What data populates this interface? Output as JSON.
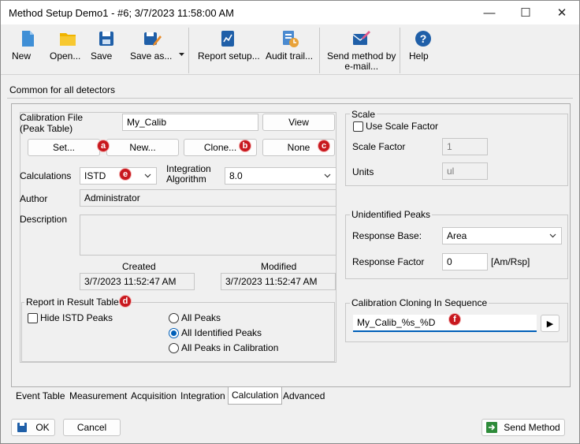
{
  "window": {
    "title": "Method Setup Demo1 - #6;  3/7/2023   11:58:00 AM",
    "minimize_glyph": "—",
    "maximize_glyph": "☐",
    "close_glyph": "✕"
  },
  "toolbar": {
    "new": "New",
    "open": "Open...",
    "save": "Save",
    "save_as": "Save as...",
    "report_setup": "Report setup...",
    "audit_trail": "Audit trail...",
    "send_method_line1": "Send method by",
    "send_method_line2": "e-mail...",
    "help": "Help"
  },
  "common_label": "Common for all detectors",
  "calibration": {
    "file_label_line1": "Calibration File",
    "file_label_line2": "(Peak Table)",
    "file_value": "My_Calib",
    "view_button": "View",
    "set_button": "Set...",
    "new_button": "New...",
    "clone_button": "Clone...",
    "none_button": "None",
    "calculations_label": "Calculations",
    "calculations_value": "ISTD",
    "integration_label_line1": "Integration",
    "integration_label_line2": "Algorithm",
    "integration_value": "8.0",
    "author_label": "Author",
    "author_value": "Administrator",
    "description_label": "Description",
    "description_value": "",
    "created_label": "Created",
    "created_value": "3/7/2023 11:52:47 AM",
    "modified_label": "Modified",
    "modified_value": "3/7/2023 11:52:47 AM"
  },
  "report": {
    "title": "Report in Result Table",
    "hide_istd": "Hide ISTD Peaks",
    "all_peaks": "All Peaks",
    "all_identified": "All Identified Peaks",
    "all_in_calibration": "All Peaks in Calibration",
    "selected": "all_identified"
  },
  "scale": {
    "title": "Scale",
    "use_scale_factor": "Use Scale Factor",
    "scale_factor_label": "Scale Factor",
    "scale_factor_value": "1",
    "units_label": "Units",
    "units_value": "ul"
  },
  "unidentified": {
    "title": "Unidentified Peaks",
    "response_base_label": "Response Base:",
    "response_base_value": "Area",
    "response_factor_label": "Response Factor",
    "response_factor_value": "0",
    "response_factor_unit": "[Am/Rsp]"
  },
  "cloning": {
    "title": "Calibration Cloning In Sequence",
    "value": "My_Calib_%s_%D",
    "arrow_glyph": "▶"
  },
  "markers": {
    "a": "a",
    "b": "b",
    "c": "c",
    "d": "d",
    "e": "e",
    "f": "f"
  },
  "tabs": [
    {
      "label": "Event Table"
    },
    {
      "label": "Measurement"
    },
    {
      "label": "Acquisition"
    },
    {
      "label": "Integration"
    },
    {
      "label": "Calculation"
    },
    {
      "label": "Advanced"
    }
  ],
  "active_tab": "Calculation",
  "footer": {
    "ok": "OK",
    "cancel": "Cancel",
    "send_method": "Send Method"
  },
  "colors": {
    "accent": "#005fb8",
    "marker": "#c8181e",
    "icon_blue": "#1f5fa8",
    "icon_folder": "#f0b400"
  }
}
